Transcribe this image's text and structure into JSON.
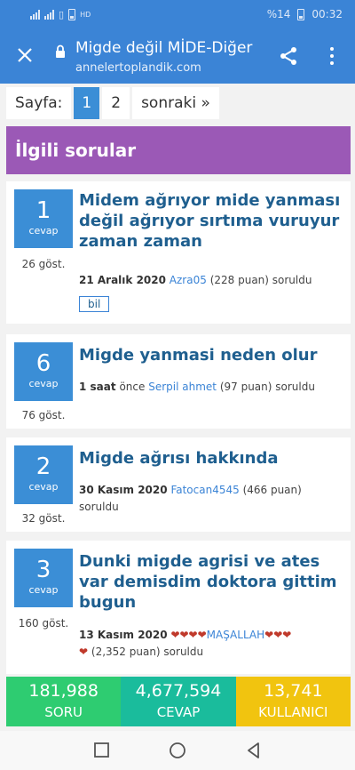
{
  "status_bar": {
    "battery_percent": "%14",
    "time": "00:32",
    "net_label": "HD"
  },
  "toolbar": {
    "title": "Migde değil MİDE-Diğer",
    "url": "annelertoplandik.com"
  },
  "pagination": {
    "label": "Sayfa:",
    "pages": [
      "1",
      "2"
    ],
    "current": "1",
    "next": "sonraki »"
  },
  "section": {
    "title": "İlgili sorular"
  },
  "questions": [
    {
      "answers": "1",
      "answers_label": "cevap",
      "views": "26 göst.",
      "title": "Midem ağrıyor mide yanması değil ağrıyor sırtıma vuruyur zaman zaman",
      "date": "21 Aralık 2020",
      "user": "Azra05",
      "points": "(228 puan) soruldu",
      "tag": "bil"
    },
    {
      "answers": "6",
      "answers_label": "cevap",
      "views": "76 göst.",
      "title": "Migde yanmasi neden olur",
      "date": "1 saat",
      "date_suffix": "önce",
      "user": "Serpil ahmet",
      "points": "(97 puan) soruldu"
    },
    {
      "answers": "2",
      "answers_label": "cevap",
      "views": "32 göst.",
      "title": "Migde ağrısı hakkında",
      "date": "30 Kasım 2020",
      "user": "Fatocan4545",
      "points": "(466 puan) soruldu"
    },
    {
      "answers": "3",
      "answers_label": "cevap",
      "views": "160 göst.",
      "title": "Dunki migde agrisi ve ates var demisdim doktora gittim bugun",
      "date": "13 Kasım 2020",
      "hearts_before": "❤❤❤❤",
      "user": "MAŞALLAH",
      "hearts_after": "❤❤❤",
      "hearts_wrap": "❤",
      "points": "(2,352 puan) soruldu"
    }
  ],
  "stats": [
    {
      "value": "181,988",
      "label": "SORU",
      "color": "#2ecc71"
    },
    {
      "value": "4,677,594",
      "label": "CEVAP",
      "color": "#1abc9c"
    },
    {
      "value": "13,741",
      "label": "KULLANICI",
      "color": "#f1c40f"
    }
  ],
  "colors": {
    "toolbar": "#3b84d6",
    "section_header": "#9b59b6",
    "answer_box": "#3b8ed6",
    "title_text": "#1f5f8f"
  }
}
